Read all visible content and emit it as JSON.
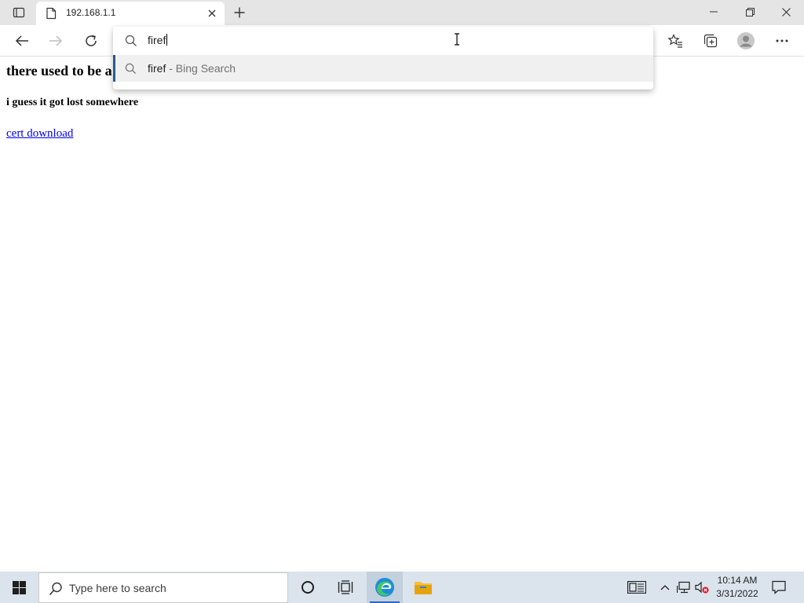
{
  "browser": {
    "tab": {
      "title": "192.168.1.1"
    },
    "address_bar": {
      "typed_value": "firef"
    },
    "suggestion": {
      "query": "firef",
      "suffix": " - Bing Search"
    }
  },
  "page": {
    "heading": "there used to be a",
    "subheading": "i guess it got lost somewhere",
    "link": "cert download"
  },
  "taskbar": {
    "search_placeholder": "Type here to search",
    "clock": {
      "time": "10:14 AM",
      "date": "3/31/2022"
    }
  },
  "icons": {
    "tab_actions": "tab-actions-icon",
    "page_favicon": "page-icon",
    "close": "close-icon",
    "new_tab": "plus-icon",
    "minimize": "minimize-icon",
    "restore": "restore-icon",
    "back": "back-arrow-icon",
    "forward": "forward-arrow-icon",
    "refresh": "refresh-icon",
    "favorites": "favorites-icon",
    "collections": "collections-icon",
    "profile": "profile-avatar-icon",
    "more": "more-icon",
    "search": "search-icon",
    "windows": "windows-logo-icon",
    "cortana": "cortana-circle-icon",
    "task_view": "task-view-icon",
    "edge": "edge-browser-icon",
    "file_explorer": "file-explorer-icon"
  },
  "colors": {
    "accent": "#2b579a",
    "link": "#0000ee",
    "taskbar": "#dbe3ec"
  }
}
